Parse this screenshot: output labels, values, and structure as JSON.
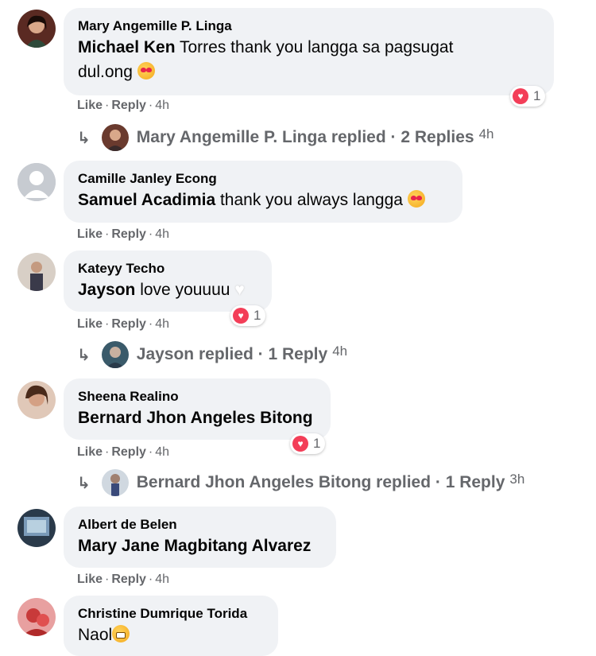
{
  "comments": [
    {
      "author": "Mary Angemille P. Linga",
      "mention": "Michael Ken",
      "text_line1": " Torres thank you langga sa pagsugat",
      "text_line2": "dul.ong",
      "emoji": "smiling-face-with-hearts-icon",
      "reaction_count": "1",
      "actions": {
        "like": "Like",
        "reply": "Reply",
        "time": "4h"
      },
      "replies": {
        "text": "Mary Angemille P. Linga replied · 2 Replies",
        "time": "4h"
      },
      "avatar_color": "#7a3b2a"
    },
    {
      "author": "Camille Janley Econg",
      "mention": "Samuel Acadimia",
      "text": " thank you always langga",
      "emoji": "smiling-face-with-hearts-icon",
      "actions": {
        "like": "Like",
        "reply": "Reply",
        "time": "4h"
      },
      "avatar_color": "#c7cbd1"
    },
    {
      "author": "Kateyy Techo",
      "mention": "Jayson",
      "text": " love youuuu",
      "emoji": "white-heart-icon",
      "reaction_count": "1",
      "actions": {
        "like": "Like",
        "reply": "Reply",
        "time": "4h"
      },
      "replies": {
        "text": "Jayson replied · 1 Reply",
        "time": "4h"
      },
      "avatar_color": "#b8a49a"
    },
    {
      "author": "Sheena Realino",
      "mention": "Bernard Jhon Angeles Bitong",
      "reaction_count": "1",
      "actions": {
        "like": "Like",
        "reply": "Reply",
        "time": "4h"
      },
      "replies": {
        "text": "Bernard Jhon Angeles Bitong replied · 1 Reply",
        "time": "3h"
      },
      "avatar_color": "#6b4a3a"
    },
    {
      "author": "Albert de Belen",
      "mention": "Mary Jane Magbitang Alvarez",
      "actions": {
        "like": "Like",
        "reply": "Reply",
        "time": "4h"
      },
      "avatar_color": "#4a5a6a"
    },
    {
      "author": "Christine Dumrique Torida",
      "text": "Naol",
      "emoji": "grinning-face-icon",
      "avatar_color": "#c83a3a"
    }
  ],
  "colors": {
    "bubble": "#f0f2f5",
    "secondary_text": "#65676b",
    "heart": "#f33e58"
  }
}
